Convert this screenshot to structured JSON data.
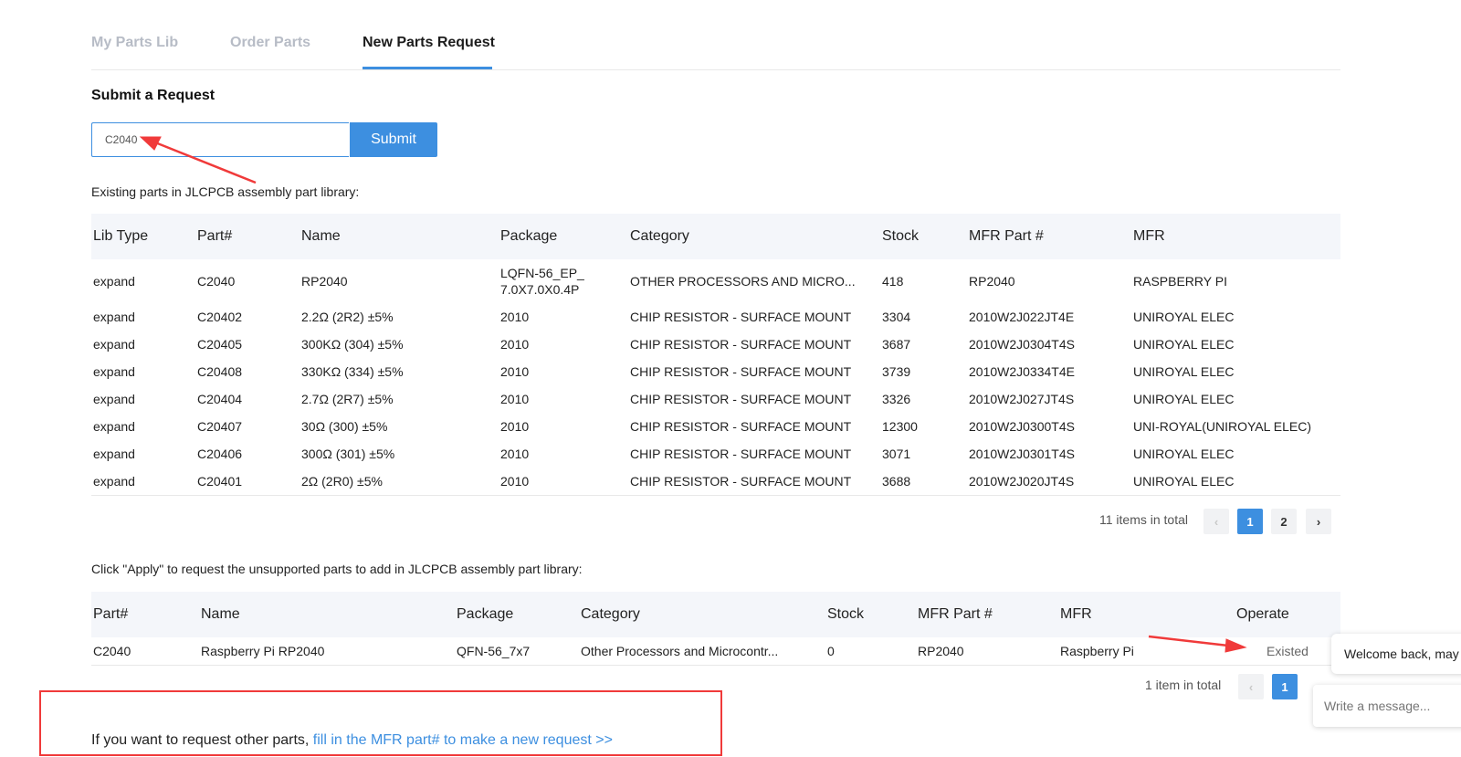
{
  "tabs": [
    {
      "label": "My Parts Lib"
    },
    {
      "label": "Order Parts"
    },
    {
      "label": "New Parts Request"
    }
  ],
  "request": {
    "title": "Submit a Request",
    "input_value": "C2040",
    "submit_label": "Submit"
  },
  "existing": {
    "note": "Existing parts in JLCPCB assembly part library:",
    "headers": [
      "Lib Type",
      "Part#",
      "Name",
      "Package",
      "Category",
      "Stock",
      "MFR Part #",
      "MFR"
    ],
    "rows": [
      [
        "expand",
        "C2040",
        "RP2040",
        "LQFN-56_EP_7.0X7.0X0.4P",
        "OTHER PROCESSORS AND MICRO...",
        "418",
        "RP2040",
        "RASPBERRY PI"
      ],
      [
        "expand",
        "C20402",
        "2.2Ω (2R2) ±5%",
        "2010",
        "CHIP RESISTOR - SURFACE MOUNT",
        "3304",
        "2010W2J022JT4E",
        "UNIROYAL ELEC"
      ],
      [
        "expand",
        "C20405",
        "300KΩ (304) ±5%",
        "2010",
        "CHIP RESISTOR - SURFACE MOUNT",
        "3687",
        "2010W2J0304T4S",
        "UNIROYAL ELEC"
      ],
      [
        "expand",
        "C20408",
        "330KΩ (334) ±5%",
        "2010",
        "CHIP RESISTOR - SURFACE MOUNT",
        "3739",
        "2010W2J0334T4E",
        "UNIROYAL ELEC"
      ],
      [
        "expand",
        "C20404",
        "2.7Ω (2R7) ±5%",
        "2010",
        "CHIP RESISTOR - SURFACE MOUNT",
        "3326",
        "2010W2J027JT4S",
        "UNIROYAL ELEC"
      ],
      [
        "expand",
        "C20407",
        "30Ω (300) ±5%",
        "2010",
        "CHIP RESISTOR - SURFACE MOUNT",
        "12300",
        "2010W2J0300T4S",
        "UNI-ROYAL(UNIROYAL ELEC)"
      ],
      [
        "expand",
        "C20406",
        "300Ω (301) ±5%",
        "2010",
        "CHIP RESISTOR - SURFACE MOUNT",
        "3071",
        "2010W2J0301T4S",
        "UNIROYAL ELEC"
      ],
      [
        "expand",
        "C20401",
        "2Ω (2R0) ±5%",
        "2010",
        "CHIP RESISTOR - SURFACE MOUNT",
        "3688",
        "2010W2J020JT4S",
        "UNIROYAL ELEC"
      ]
    ],
    "pager": {
      "total": "11 items in total",
      "prev": "‹",
      "pages": [
        "1",
        "2"
      ],
      "next": "›"
    }
  },
  "unsupported": {
    "note": "Click \"Apply\" to request the unsupported parts to add in JLCPCB assembly part library:",
    "headers": [
      "Part#",
      "Name",
      "Package",
      "Category",
      "Stock",
      "MFR Part #",
      "MFR",
      "Operate"
    ],
    "rows": [
      [
        "C2040",
        "Raspberry Pi RP2040",
        "QFN-56_7x7",
        "Other Processors and Microcontr...",
        "0",
        "RP2040",
        "Raspberry Pi",
        "Existed"
      ]
    ],
    "pager": {
      "total": "1 item in total",
      "prev": "‹",
      "pages": [
        "1"
      ]
    }
  },
  "footer": {
    "text": "If you want to request other parts, ",
    "link": "fill in the MFR part# to make a new request >>"
  },
  "chat": {
    "bubble": "Welcome back, may I",
    "placeholder": "Write a message..."
  },
  "colors": {
    "accent": "#3d8fe0",
    "annotation": "#f03a3a"
  }
}
